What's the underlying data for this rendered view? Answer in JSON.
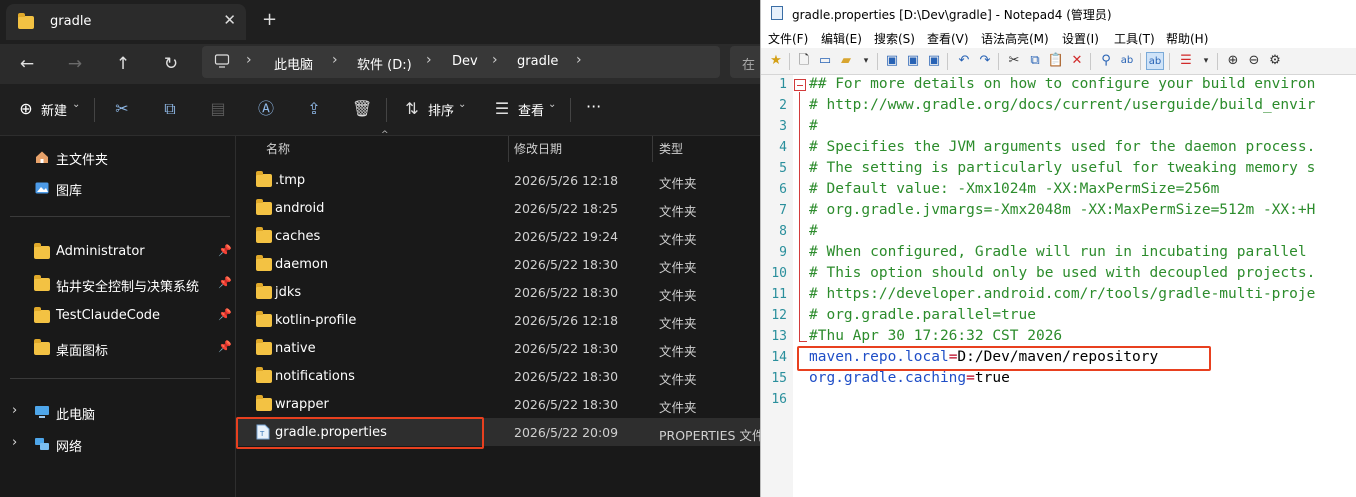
{
  "explorer": {
    "tab_title": "gradle",
    "new_tab": "+",
    "tab_close": "✕",
    "breadcrumbs": [
      "此电脑",
      "软件 (D:)",
      "Dev",
      "gradle"
    ],
    "search_placeholder": "在",
    "commands": {
      "new": "新建",
      "sort": "排序",
      "view": "查看",
      "more": "···"
    },
    "sidebar": {
      "top_items": [
        {
          "label": "主文件夹",
          "icon": "home-icon"
        },
        {
          "label": "图库",
          "icon": "gallery-icon"
        }
      ],
      "pinned": [
        {
          "label": "Administrator"
        },
        {
          "label": "钻井安全控制与决策系统"
        },
        {
          "label": "TestClaudeCode"
        },
        {
          "label": "桌面图标"
        }
      ],
      "tree": [
        {
          "label": "此电脑",
          "icon": "pc-icon"
        },
        {
          "label": "网络",
          "icon": "network-icon"
        }
      ]
    },
    "columns": {
      "name": "名称",
      "modified": "修改日期",
      "type": "类型"
    },
    "files": [
      {
        "name": ".tmp",
        "date": "2026/5/26 12:18",
        "type": "文件夹"
      },
      {
        "name": "android",
        "date": "2026/5/22 18:25",
        "type": "文件夹"
      },
      {
        "name": "caches",
        "date": "2026/5/22 19:24",
        "type": "文件夹"
      },
      {
        "name": "daemon",
        "date": "2026/5/22 18:30",
        "type": "文件夹"
      },
      {
        "name": "jdks",
        "date": "2026/5/22 18:30",
        "type": "文件夹"
      },
      {
        "name": "kotlin-profile",
        "date": "2026/5/26 12:18",
        "type": "文件夹"
      },
      {
        "name": "native",
        "date": "2026/5/22 18:30",
        "type": "文件夹"
      },
      {
        "name": "notifications",
        "date": "2026/5/22 18:30",
        "type": "文件夹"
      },
      {
        "name": "wrapper",
        "date": "2026/5/22 18:30",
        "type": "文件夹"
      },
      {
        "name": "gradle.properties",
        "date": "2026/5/22 20:09",
        "type": "PROPERTIES 文件"
      }
    ]
  },
  "notepad": {
    "title": "gradle.properties [D:\\Dev\\gradle] - Notepad4 (管理员)",
    "menu": [
      "文件(F)",
      "编辑(E)",
      "搜索(S)",
      "查看(V)",
      "语法高亮(M)",
      "设置(I)",
      "工具(T)",
      "帮助(H)"
    ],
    "line_numbers": [
      "1",
      "2",
      "3",
      "4",
      "5",
      "6",
      "7",
      "8",
      "9",
      "10",
      "11",
      "12",
      "13",
      "14",
      "15",
      "16"
    ],
    "lines": [
      "## For more details on how to configure your build environ",
      "# http://www.gradle.org/docs/current/userguide/build_envir",
      "#",
      "# Specifies the JVM arguments used for the daemon process.",
      "# The setting is particularly useful for tweaking memory s",
      "# Default value: -Xmx1024m -XX:MaxPermSize=256m",
      "# org.gradle.jvmargs=-Xmx2048m -XX:MaxPermSize=512m -XX:+H",
      "#",
      "# When configured, Gradle will run in incubating parallel",
      "# This option should only be used with decoupled projects.",
      "# https://developer.android.com/r/tools/gradle-multi-proje",
      "# org.gradle.parallel=true",
      "#Thu Apr 30 17:26:32 CST 2026"
    ],
    "line14": {
      "key": "maven.repo.local",
      "eq": "=",
      "value": "D:/Dev/maven/repository"
    },
    "line15": {
      "key": "org.gradle.caching",
      "eq": "=",
      "value": "true"
    },
    "colors": {
      "comment": "#2c8c2c",
      "key": "#1f4ec7",
      "highlight_box": "#e8401f"
    }
  }
}
